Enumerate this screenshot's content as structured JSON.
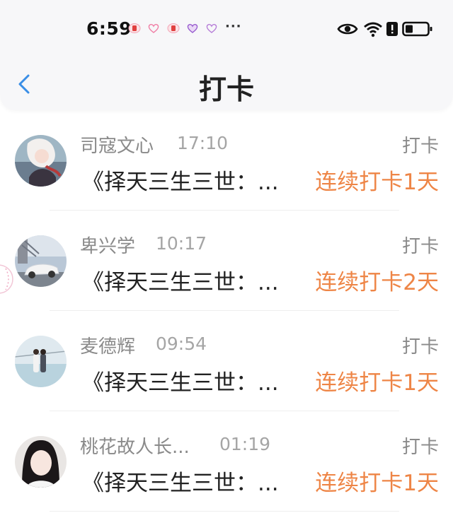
{
  "status_bar": {
    "time": "6:59",
    "more": "···",
    "notification_icons": [
      "notif-red-badge-icon",
      "notif-heart-icon",
      "notif-red-badge-icon",
      "notif-purple-heart-icon",
      "notif-heart-icon"
    ],
    "right_icons": [
      "eye-icon",
      "wifi-icon",
      "alert-icon",
      "battery-icon"
    ]
  },
  "nav": {
    "title": "打卡",
    "back_icon": "chevron-left-icon",
    "accent": "#3a8ee6"
  },
  "colors": {
    "streak": "#ee8546",
    "name": "#8a8a8a",
    "book": "#222222"
  },
  "items": [
    {
      "name": "司寇文心",
      "time": "17:10",
      "action": "打卡",
      "book": "《择天三生三世：...",
      "streak": "连续打卡1天"
    },
    {
      "name": "卑兴学",
      "time": "10:17",
      "action": "打卡",
      "book": "《择天三生三世：...",
      "streak": "连续打卡2天"
    },
    {
      "name": "麦德辉",
      "time": "09:54",
      "action": "打卡",
      "book": "《择天三生三世：...",
      "streak": "连续打卡1天"
    },
    {
      "name": "桃花故人长...",
      "time": "01:19",
      "action": "打卡",
      "book": "《择天三生三世：...",
      "streak": "连续打卡1天"
    }
  ]
}
